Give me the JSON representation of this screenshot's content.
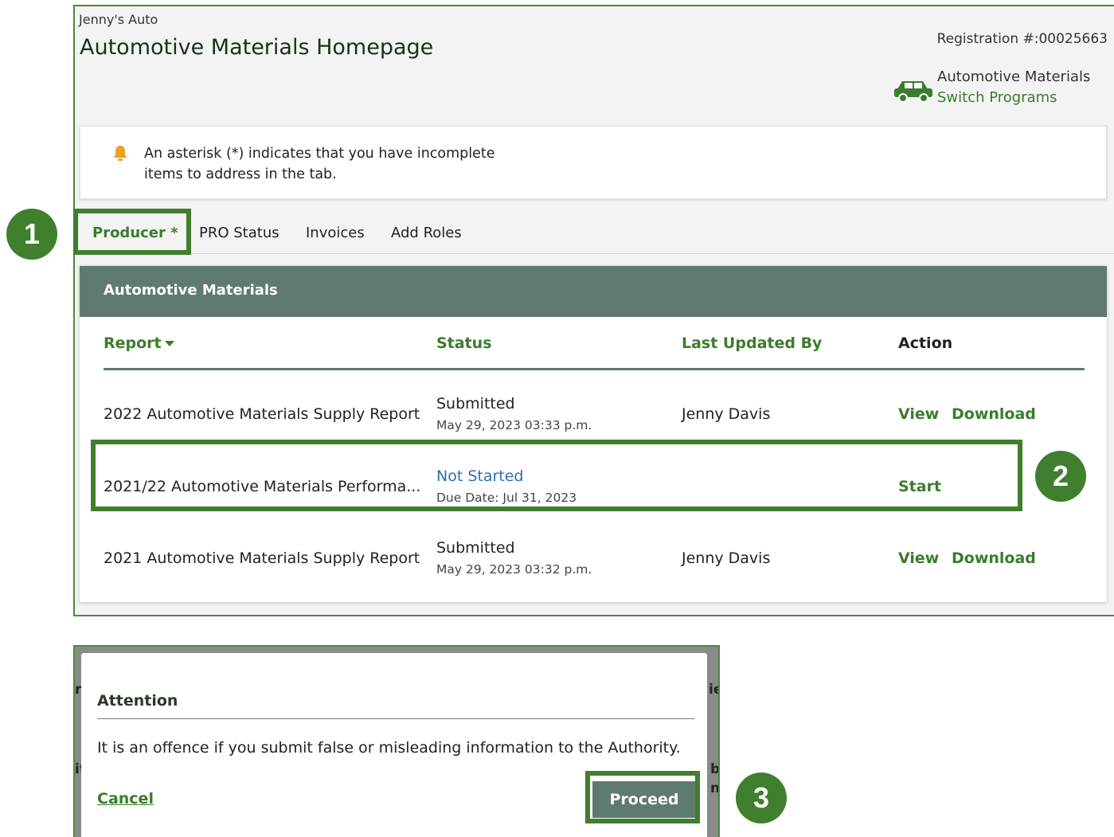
{
  "header": {
    "company": "Jenny's Auto",
    "title": "Automotive Materials Homepage",
    "registration": "Registration #:00025663",
    "program_name": "Automotive Materials",
    "switch_label": "Switch Programs"
  },
  "notice": {
    "line1": "An asterisk (*) indicates that you have incomplete",
    "line2": "items to address in the tab."
  },
  "tabs": [
    {
      "label": "Producer *",
      "active": true
    },
    {
      "label": "PRO Status"
    },
    {
      "label": "Invoices"
    },
    {
      "label": "Add Roles"
    }
  ],
  "card": {
    "title": "Automotive Materials",
    "columns": [
      "Report",
      "Status",
      "Last Updated By",
      "Action"
    ],
    "rows": [
      {
        "report": "2022 Automotive Materials Supply Report",
        "status": "Submitted",
        "status_sub": "May 29, 2023 03:33 p.m.",
        "updated_by": "Jenny Davis",
        "actions": [
          "View",
          "Download"
        ]
      },
      {
        "report": "2021/22 Automotive Materials Performa...",
        "status": "Not Started",
        "status_sub": "Due Date: Jul 31, 2023",
        "updated_by": "",
        "actions": [
          "Start"
        ]
      },
      {
        "report": "2021 Automotive Materials Supply Report",
        "status": "Submitted",
        "status_sub": "May 29, 2023 03:32 p.m.",
        "updated_by": "Jenny Davis",
        "actions": [
          "View",
          "Download"
        ]
      }
    ]
  },
  "modal": {
    "title": "Attention",
    "body": "It is an offence if you submit false or misleading information to the Authority.",
    "cancel": "Cancel",
    "proceed": "Proceed"
  },
  "steps": [
    "1",
    "2",
    "3"
  ],
  "colors": {
    "brand_green": "#3a7d2c",
    "highlight_green": "#3f7f2e",
    "header_teal": "#5f7b70",
    "link_blue": "#2f6fb5",
    "bell_orange": "#f0a020"
  }
}
